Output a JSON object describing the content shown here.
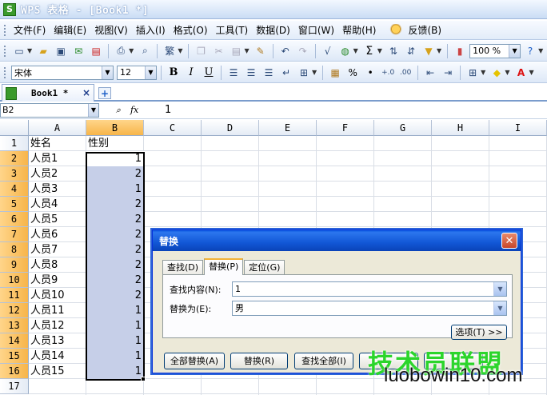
{
  "window": {
    "title": "WPS 表格 - [Book1 *]",
    "app_icon": "S"
  },
  "menu": {
    "items": [
      "文件(F)",
      "编辑(E)",
      "视图(V)",
      "插入(I)",
      "格式(O)",
      "工具(T)",
      "数据(D)",
      "窗口(W)",
      "帮助(H)"
    ],
    "feedback": "反馈(B)"
  },
  "toolbar_font": {
    "font_name": "宋体",
    "font_size": "12",
    "bold": "B",
    "italic": "I",
    "underline": "U",
    "percent": "%"
  },
  "toolbar_std": {
    "zoom": "100 %",
    "sum": "Σ"
  },
  "doc_tab": {
    "label": "Book1 *",
    "close": "×",
    "add": "+"
  },
  "formula_bar": {
    "name_box": "B2",
    "fx": "fx",
    "value": "1"
  },
  "sheet": {
    "columns": [
      "A",
      "B",
      "C",
      "D",
      "E",
      "F",
      "G",
      "H",
      "I"
    ],
    "rows": [
      "1",
      "2",
      "3",
      "4",
      "5",
      "6",
      "7",
      "8",
      "9",
      "10",
      "11",
      "12",
      "13",
      "14",
      "15",
      "16",
      "17"
    ],
    "col_a": [
      "姓名",
      "人员1",
      "人员2",
      "人员3",
      "人员4",
      "人员5",
      "人员6",
      "人员7",
      "人员8",
      "人员9",
      "人员10",
      "人员11",
      "人员12",
      "人员13",
      "人员14",
      "人员15"
    ],
    "col_b_header": "性别",
    "col_b": [
      "1",
      "2",
      "1",
      "2",
      "2",
      "2",
      "2",
      "2",
      "2",
      "2",
      "1",
      "1",
      "1",
      "1",
      "1"
    ]
  },
  "dialog": {
    "title": "替换",
    "close": "✕",
    "tabs": [
      "查找(D)",
      "替换(P)",
      "定位(G)"
    ],
    "find_label": "查找内容(N):",
    "find_value": "1",
    "replace_label": "替换为(E):",
    "replace_value": "男",
    "options_button": "选项(T) >>",
    "replace_all": "全部替换(A)",
    "replace": "替换(R)",
    "find_all": "查找全部(I)"
  },
  "watermark": {
    "cn": "技术员联盟",
    "en": "luobowin10.com"
  },
  "colors": {
    "accent": "#0a5ae0",
    "selection": "#c6cfe8",
    "header_sel": "#f7b54a",
    "watermark_green": "#2bd52b"
  }
}
